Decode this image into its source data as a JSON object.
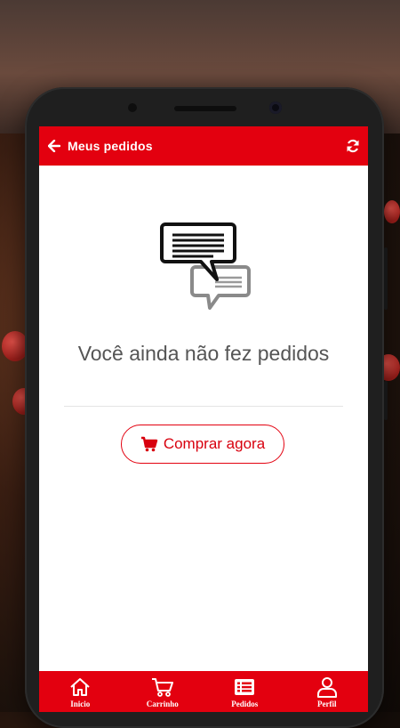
{
  "appbar": {
    "title": "Meus pedidos"
  },
  "empty_state": {
    "message": "Você ainda não fez pedidos",
    "button_label": "Comprar agora",
    "icon": "chat-bubbles-icon"
  },
  "bottom_nav": {
    "items": [
      {
        "label": "Inicio",
        "icon": "home-icon"
      },
      {
        "label": "Carrinho",
        "icon": "cart-icon"
      },
      {
        "label": "Pedidos",
        "icon": "orders-list-icon"
      },
      {
        "label": "Perfil",
        "icon": "profile-icon"
      }
    ]
  },
  "colors": {
    "primary": "#e3000f",
    "text": "#555555",
    "background": "#ffffff"
  }
}
